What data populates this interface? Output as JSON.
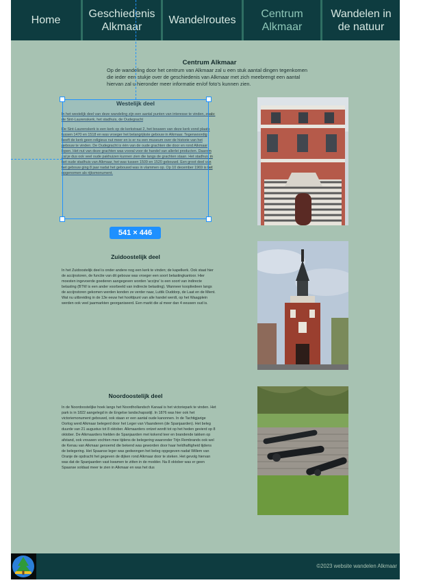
{
  "nav": {
    "items": [
      {
        "label_lines": [
          "Home"
        ],
        "active": false
      },
      {
        "label_lines": [
          "Geschiedenis",
          "Alkmaar"
        ],
        "active": false
      },
      {
        "label_lines": [
          "Wandelroutes"
        ],
        "active": false
      },
      {
        "label_lines": [
          "Centrum",
          "Alkmaar"
        ],
        "active": true
      },
      {
        "label_lines": [
          "Wandelen in",
          "de natuur"
        ],
        "active": false
      }
    ]
  },
  "intro": {
    "title": "Centrum Alkmaar",
    "text": "Op de wandeling door het centrum van Alkmaar zal u een stuk aantal dingen tegenkomen die ieder een stukje over de geschiedenis van Alkmaar met zich meebrengt een aantal hiervan zal u hieronder meer informatie en/of foto's kunnen zien."
  },
  "sections": {
    "west": {
      "title": "Westelijk deel",
      "paragraphs": [
        "In het westelijk deel van deze wandeling zijn een aantal punten van interesse te vinden, zoals: de Sint-Laurenskerk, het stadhuis, de Oudegracht",
        "De Sint-Laurenskerk is een kerk op de kerkstraat 2, het bouwen van deze kerk vond plaats tussen 1470 en 1518 en was vroeger het belangrijkste gebouw in Alkmaar. Tegenwoordig heeft de kerk geen religieus nut meer en is er nu een museum over de historie van het gebouw te vinden. De Oudegracht is één van de oude grachten die door en rond Alkmaar lopen. Het nut van deze grachten was vooral voor de handel van allerlei producten. Daarom zal je dus ook veel oude pakhuizen kunnen zien die langs de grachten staan. Het stadhuis in het oude stadhuis van Alkmaar, het was tussen 1509 en 1520 gebouwd. Een groot deel van het gebouw ging 8 jaar nadat het gebouwd was in vlammen op. Op 10 december 1969 is het opgenomen als rijksmonument."
      ]
    },
    "southeast": {
      "title": "Zuidoostelijk deel",
      "text": "In het Zuidoostelijk deel is onder andere nog een kerk te vinden; de kapelkerk. Ook staat hier de accijnstoren, de functie van dit gebouw was vroeger een soort belastingkantoor. Hier moesten ingevoerde goederen aangegeven worden 'accijns' is een soort van indirecte belasting (BTW is een ander voorbeeld van indirecte belasting). Wanneer koopliedeen langs de accijnstoren gekomen werden konden ze verder naar, Luttik Ouddorp, de Laat en de Mient. Wat nu uitbreiding in de 13e eeuw het hoofdpunt van alle handel werdt, op het Waagplein werden ook veel jaarmarkten georganiseerd. Een markt die al meer dan 4 eeuwen oud is."
    },
    "northeast": {
      "title": "Noordoostelijk deel",
      "text": "In de Noordoostelijke hoek langs het Noordhollandsch Kanaal is het victoriepark te vinden. Het park is in 1822 aangelegd in de Engelse landschapsstijl. In 1876 was hier ook het victoriemonument gebouwd, ook staan er een aantal oude kanonnen. In de Tachtigjarige Oorlog werd Alkmaar belegerd door het Leger van Vlaanderen (de Spanjaarden). Het beleg duurde van 21 augustus tot 8 oktober. Alkmaarders ontzet wordt tot op het heden gevierd op 8 oktober. De Alkmaarders hielden de Spanjaarden met kokend teer en brandende takken op afstand, ook vrouwen vochten mee tijdens de belegering waaronder Trijn Rembrands ook wel de Kenau van Alkmaar genoemd die bekend was geworden door haar heldhaftigheid tijdens de belegering. Het Spaanse leger was gedwongen het beleg opgegeven nadat Willem van Oranje de opdracht het gegeven de dijken rond Alkmaar door te steken. Het gevolg hiervan was dat de Spanjaarden vast kwamen te zitten in de modder. Na 8 oktober was er geen Spaanse soldaat meer te zien in Alkmaar en was het dus"
    }
  },
  "selection": {
    "size_label": "541 × 446"
  },
  "footer": {
    "copyright": "©2023 website wandelen Alkmaar"
  },
  "colors": {
    "page_bg": "#a7c2b2",
    "nav_bg": "#0e3c40",
    "accent": "#1e90ff"
  }
}
